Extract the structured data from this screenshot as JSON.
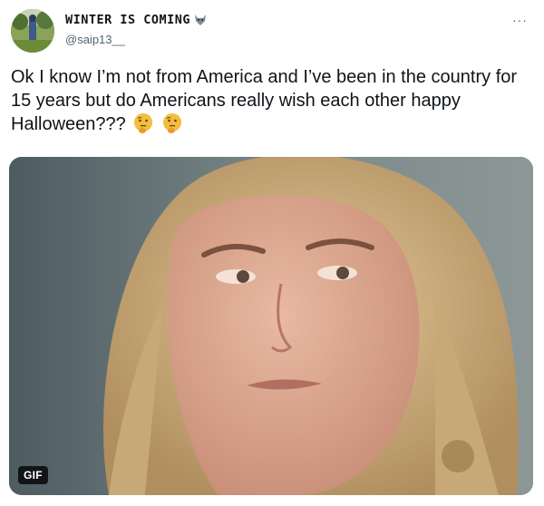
{
  "tweet": {
    "display_name": "WINTER IS COMING",
    "handle": "@saip13__",
    "more_label": "···",
    "text": "Ok I know I’m not from America and I’ve been in the country for 15 years but do Americans really wish each other happy Halloween???",
    "emojis": [
      "thinking-face-icon",
      "thinking-face-icon"
    ],
    "media": {
      "type": "gif",
      "badge": "GIF"
    }
  },
  "colors": {
    "text": "#0f1419",
    "secondary": "#536471",
    "badge_bg": "#000000"
  }
}
